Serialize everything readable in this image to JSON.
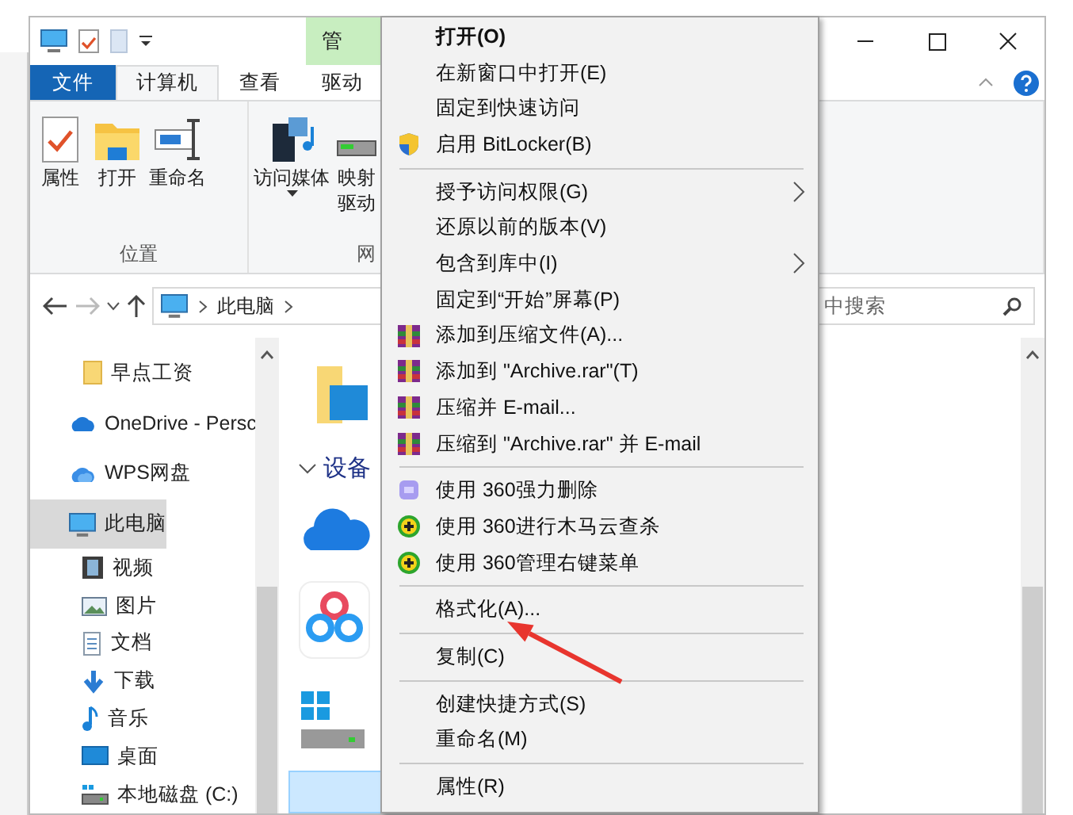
{
  "window": {
    "contextual_tab_header": "管"
  },
  "tabs": [
    {
      "label": "文件",
      "kind": "file",
      "selected": false
    },
    {
      "label": "计算机",
      "kind": "tab",
      "selected": true
    },
    {
      "label": "查看",
      "kind": "tab",
      "selected": false
    },
    {
      "label": "驱动",
      "kind": "tab",
      "selected": false
    }
  ],
  "ribbon": {
    "groups": [
      {
        "label": "位置",
        "buttons": [
          {
            "lines": [
              "属性"
            ],
            "kind": "properties",
            "dropdown": false
          },
          {
            "lines": [
              "打开"
            ],
            "kind": "open",
            "dropdown": false
          },
          {
            "lines": [
              "重命名"
            ],
            "kind": "rename",
            "dropdown": false
          }
        ]
      },
      {
        "label": "网",
        "buttons": [
          {
            "lines": [
              "访问媒体"
            ],
            "kind": "media",
            "dropdown": true
          },
          {
            "lines": [
              "映射",
              "驱动"
            ],
            "kind": "drive",
            "dropdown": false
          }
        ]
      }
    ]
  },
  "address_bar": {
    "path": [
      "此电脑"
    ]
  },
  "search": {
    "placeholder": "中搜索"
  },
  "nav_pane": {
    "items": [
      {
        "label": "早点工资",
        "kind": "folder",
        "selected": false
      },
      {
        "label": "OneDrive - Persc",
        "kind": "onedrive",
        "selected": false
      },
      {
        "label": "WPS网盘",
        "kind": "wps",
        "selected": false
      },
      {
        "label": "此电脑",
        "kind": "pc",
        "selected": true,
        "children": [
          {
            "label": "视频",
            "kind": "video",
            "selected": false
          },
          {
            "label": "图片",
            "kind": "pictures",
            "selected": false
          },
          {
            "label": "文档",
            "kind": "documents",
            "selected": false
          },
          {
            "label": "下载",
            "kind": "downloads",
            "selected": false
          },
          {
            "label": "音乐",
            "kind": "music",
            "selected": false
          },
          {
            "label": "桌面",
            "kind": "desktop",
            "selected": false
          },
          {
            "label": "本地磁盘 (C:)",
            "kind": "disk",
            "selected": false
          }
        ]
      }
    ]
  },
  "content": {
    "group_header": "设备",
    "expanded": true
  },
  "context_menu": {
    "items": [
      {
        "label": "打开(O)",
        "kind": "plain",
        "default": true,
        "submenu": false
      },
      {
        "label": "在新窗口中打开(E)",
        "kind": "plain",
        "default": false,
        "submenu": false
      },
      {
        "label": "固定到快速访问",
        "kind": "plain",
        "default": false,
        "submenu": false
      },
      {
        "label": "启用 BitLocker(B)",
        "kind": "shield",
        "default": false,
        "submenu": false
      },
      {
        "kind": "separator"
      },
      {
        "label": "授予访问权限(G)",
        "kind": "plain",
        "default": false,
        "submenu": true
      },
      {
        "label": "还原以前的版本(V)",
        "kind": "plain",
        "default": false,
        "submenu": false
      },
      {
        "label": "包含到库中(I)",
        "kind": "plain",
        "default": false,
        "submenu": true
      },
      {
        "label": "固定到“开始”屏幕(P)",
        "kind": "plain",
        "default": false,
        "submenu": false
      },
      {
        "label": "添加到压缩文件(A)...",
        "kind": "archive",
        "default": false,
        "submenu": false
      },
      {
        "label": "添加到 \"Archive.rar\"(T)",
        "kind": "archive",
        "default": false,
        "submenu": false
      },
      {
        "label": "压缩并 E-mail...",
        "kind": "archive",
        "default": false,
        "submenu": false
      },
      {
        "label": "压缩到 \"Archive.rar\" 并 E-mail",
        "kind": "archive",
        "default": false,
        "submenu": false
      },
      {
        "kind": "separator"
      },
      {
        "label": "使用 360强力删除",
        "kind": "shredder",
        "default": false,
        "submenu": false
      },
      {
        "label": "使用 360进行木马云查杀",
        "kind": "guard",
        "default": false,
        "submenu": false
      },
      {
        "label": "使用 360管理右键菜单",
        "kind": "guard",
        "default": false,
        "submenu": false
      },
      {
        "kind": "separator"
      },
      {
        "label": "格式化(A)...",
        "kind": "plain",
        "default": false,
        "submenu": false
      },
      {
        "kind": "separator"
      },
      {
        "label": "复制(C)",
        "kind": "plain",
        "default": false,
        "submenu": false
      },
      {
        "kind": "separator"
      },
      {
        "label": "创建快捷方式(S)",
        "kind": "plain",
        "default": false,
        "submenu": false
      },
      {
        "label": "重命名(M)",
        "kind": "plain",
        "default": false,
        "submenu": false
      },
      {
        "kind": "separator"
      },
      {
        "label": "属性(R)",
        "kind": "plain",
        "default": false,
        "submenu": false
      }
    ]
  }
}
